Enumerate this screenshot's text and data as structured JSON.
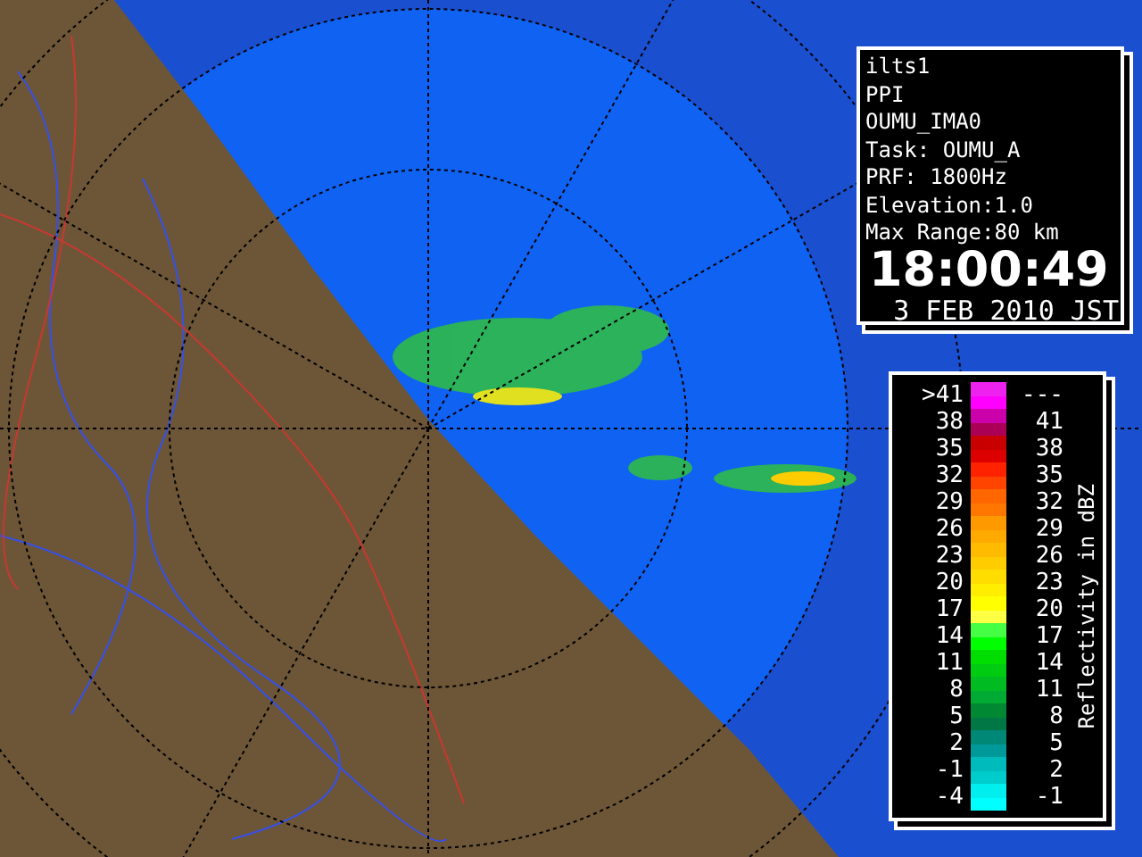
{
  "info_panel": {
    "lines": [
      "ilts1",
      "PPI",
      "OUMU_IMA0",
      "Task: OUMU_A",
      "PRF: 1800Hz",
      "Elevation:1.0",
      "Max Range:80 km"
    ],
    "time": "18:00:49",
    "date": "3 FEB 2010 JST"
  },
  "legend": {
    "title": "Reflectivity in dBZ",
    "rows": [
      {
        "low": ">41",
        "high": "---",
        "swatches": [
          {
            "color": "#ee22ee"
          },
          {
            "color": "#ff00ff"
          }
        ]
      },
      {
        "low": "38",
        "high": "41",
        "swatches": [
          {
            "color": "#cc00aa"
          },
          {
            "color": "#aa0055"
          }
        ]
      },
      {
        "low": "35",
        "high": "38",
        "swatches": [
          {
            "color": "#c80000"
          },
          {
            "color": "#dd0000"
          }
        ]
      },
      {
        "low": "32",
        "high": "35",
        "swatches": [
          {
            "color": "#ff2200"
          },
          {
            "color": "#ff4400"
          }
        ]
      },
      {
        "low": "29",
        "high": "32",
        "swatches": [
          {
            "color": "#ff6600"
          },
          {
            "color": "#ff7700"
          }
        ]
      },
      {
        "low": "26",
        "high": "29",
        "swatches": [
          {
            "color": "#ff9900"
          },
          {
            "color": "#ffaa00"
          }
        ]
      },
      {
        "low": "23",
        "high": "26",
        "swatches": [
          {
            "color": "#ffbb00"
          },
          {
            "color": "#ffcc00"
          }
        ]
      },
      {
        "low": "20",
        "high": "23",
        "swatches": [
          {
            "color": "#ffdd00"
          },
          {
            "color": "#ffee00"
          }
        ]
      },
      {
        "low": "17",
        "high": "20",
        "swatches": [
          {
            "color": "#ffff00"
          },
          {
            "color": "#ffff44"
          }
        ]
      },
      {
        "low": "14",
        "high": "17",
        "swatches": [
          {
            "color": "#44ff44"
          },
          {
            "color": "#00ff00"
          }
        ]
      },
      {
        "low": "11",
        "high": "14",
        "swatches": [
          {
            "color": "#00dd00"
          },
          {
            "color": "#00cc11"
          }
        ]
      },
      {
        "low": "8",
        "high": "11",
        "swatches": [
          {
            "color": "#00bb22"
          },
          {
            "color": "#00aa33"
          }
        ]
      },
      {
        "low": "5",
        "high": "8",
        "swatches": [
          {
            "color": "#008833"
          },
          {
            "color": "#007744"
          }
        ]
      },
      {
        "low": "2",
        "high": "5",
        "swatches": [
          {
            "color": "#008877"
          },
          {
            "color": "#009999"
          }
        ]
      },
      {
        "low": "-1",
        "high": "2",
        "swatches": [
          {
            "color": "#00bbbb"
          },
          {
            "color": "#00cccc"
          }
        ]
      },
      {
        "low": "-4",
        "high": "-1",
        "swatches": [
          {
            "color": "#00eeee"
          },
          {
            "color": "#00ffff"
          }
        ]
      }
    ]
  }
}
